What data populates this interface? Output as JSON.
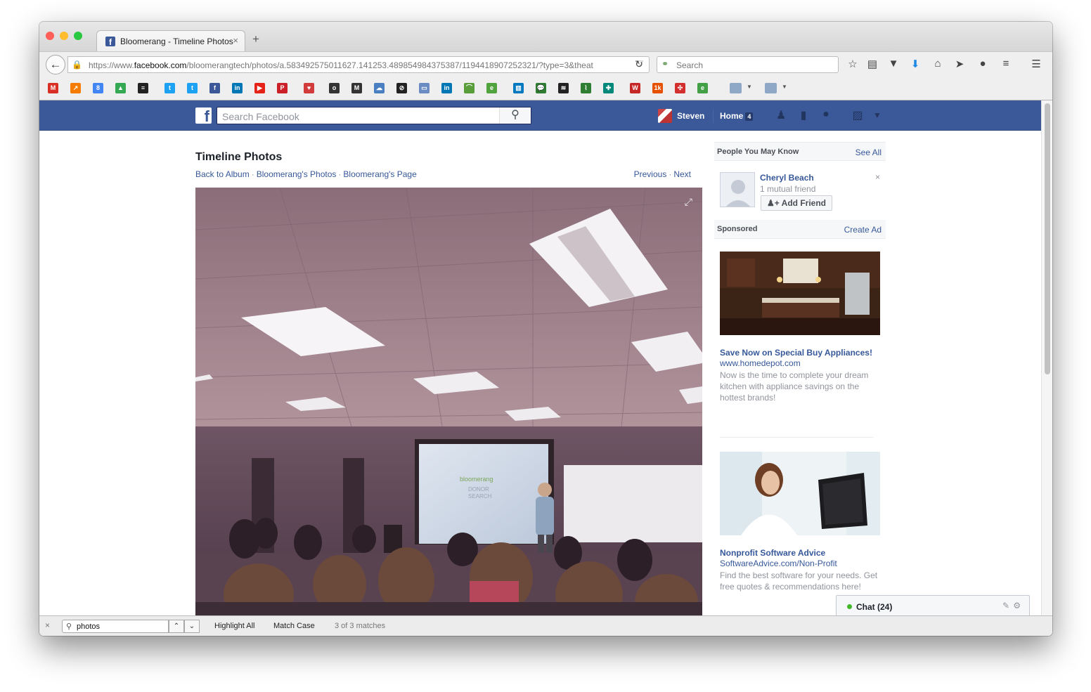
{
  "browser": {
    "tab_title": "Bloomerang - Timeline Photos",
    "tab_close": "×",
    "new_tab": "+",
    "url_prefix": "https://www.",
    "url_domain": "facebook.com",
    "url_rest": "/bloomerangtech/photos/a.583492575011627.141253.489854984375387/1194418907252321/?type=3&theat",
    "search_placeholder": "Search",
    "colors": {
      "close": "#ff5f57",
      "minimize": "#febc2e",
      "zoom": "#28c840"
    }
  },
  "bookmarks": [
    {
      "icon": "gmail-icon",
      "glyph": "M",
      "color": "#d93025"
    },
    {
      "icon": "chart-icon",
      "glyph": "↗",
      "color": "#f57c00"
    },
    {
      "icon": "calendar-icon",
      "glyph": "8",
      "color": "#4285f4"
    },
    {
      "icon": "drive-icon",
      "glyph": "▲",
      "color": "#34a853"
    },
    {
      "icon": "buffer-icon",
      "glyph": "≡",
      "color": "#222222"
    },
    {
      "icon": "twitter-icon",
      "glyph": "t",
      "color": "#1da1f2"
    },
    {
      "icon": "twitter-icon",
      "glyph": "t",
      "color": "#1da1f2"
    },
    {
      "icon": "facebook-icon",
      "glyph": "f",
      "color": "#3b5998"
    },
    {
      "icon": "linkedin-icon",
      "glyph": "in",
      "color": "#0077b5"
    },
    {
      "icon": "youtube-icon",
      "glyph": "▶",
      "color": "#e62117"
    },
    {
      "icon": "pinterest-icon",
      "glyph": "P",
      "color": "#cb2027"
    },
    {
      "icon": "heart-icon",
      "glyph": "♥",
      "color": "#d23b3b"
    },
    {
      "icon": "hootsuite-icon",
      "glyph": "o",
      "color": "#333333"
    },
    {
      "icon": "mail-icon",
      "glyph": "M",
      "color": "#333333"
    },
    {
      "icon": "cloud-icon",
      "glyph": "☁",
      "color": "#4a7fc1"
    },
    {
      "icon": "speed-icon",
      "glyph": "⊘",
      "color": "#222222"
    },
    {
      "icon": "window-icon",
      "glyph": "▭",
      "color": "#6b8bc3"
    },
    {
      "icon": "linkedin-icon",
      "glyph": "in",
      "color": "#0077b5"
    },
    {
      "icon": "analytics-icon",
      "glyph": "⌒",
      "color": "#5a9e3c"
    },
    {
      "icon": "evernote-icon",
      "glyph": "e",
      "color": "#51a33d"
    },
    {
      "icon": "trello-icon",
      "glyph": "▥",
      "color": "#0079bf"
    },
    {
      "icon": "chat-bubble-icon",
      "glyph": "💬",
      "color": "#2e7d32"
    },
    {
      "icon": "wifi-icon",
      "glyph": "≋",
      "color": "#222222"
    },
    {
      "icon": "leaf-icon",
      "glyph": "⌇",
      "color": "#2e7d32"
    },
    {
      "icon": "tool-icon",
      "glyph": "✚",
      "color": "#00897b"
    },
    {
      "icon": "w-icon",
      "glyph": "W",
      "color": "#c62828"
    },
    {
      "icon": "kplus-icon",
      "glyph": "1k",
      "color": "#e65100"
    },
    {
      "icon": "puzzle-icon",
      "glyph": "✣",
      "color": "#d32f2f"
    },
    {
      "icon": "evernote-icon",
      "glyph": "e",
      "color": "#43a047"
    }
  ],
  "facebook": {
    "search_placeholder": "Search Facebook",
    "user_name": "Steven",
    "home_label": "Home",
    "home_count": "4"
  },
  "page": {
    "title": "Timeline Photos",
    "crumb_album": "Back to Album",
    "crumb_sep": "·",
    "crumb_photos": "Bloomerang's Photos",
    "crumb_page": "Bloomerang's Page",
    "prev": "Previous",
    "next": "Next"
  },
  "sidebar": {
    "pymk_title": "People You May Know",
    "see_all": "See All",
    "person_name": "Cheryl Beach",
    "person_mutual": "1 mutual friend",
    "add_friend": "Add Friend",
    "sponsored": "Sponsored",
    "create_ad": "Create Ad",
    "ads": [
      {
        "headline": "Save Now on Special Buy Appliances!",
        "site": "www.homedepot.com",
        "desc": "Now is the time to complete your dream kitchen with appliance savings on the hottest brands!"
      },
      {
        "headline": "Nonprofit Software Advice",
        "site": "SoftwareAdvice.com/Non-Profit",
        "desc": "Find the best software for your needs. Get free quotes & recommendations here!"
      }
    ]
  },
  "chat": {
    "label": "Chat (24)"
  },
  "findbar": {
    "query": "photos",
    "highlight_all": "Highlight All",
    "match_case": "Match Case",
    "status": "3 of 3 matches"
  }
}
